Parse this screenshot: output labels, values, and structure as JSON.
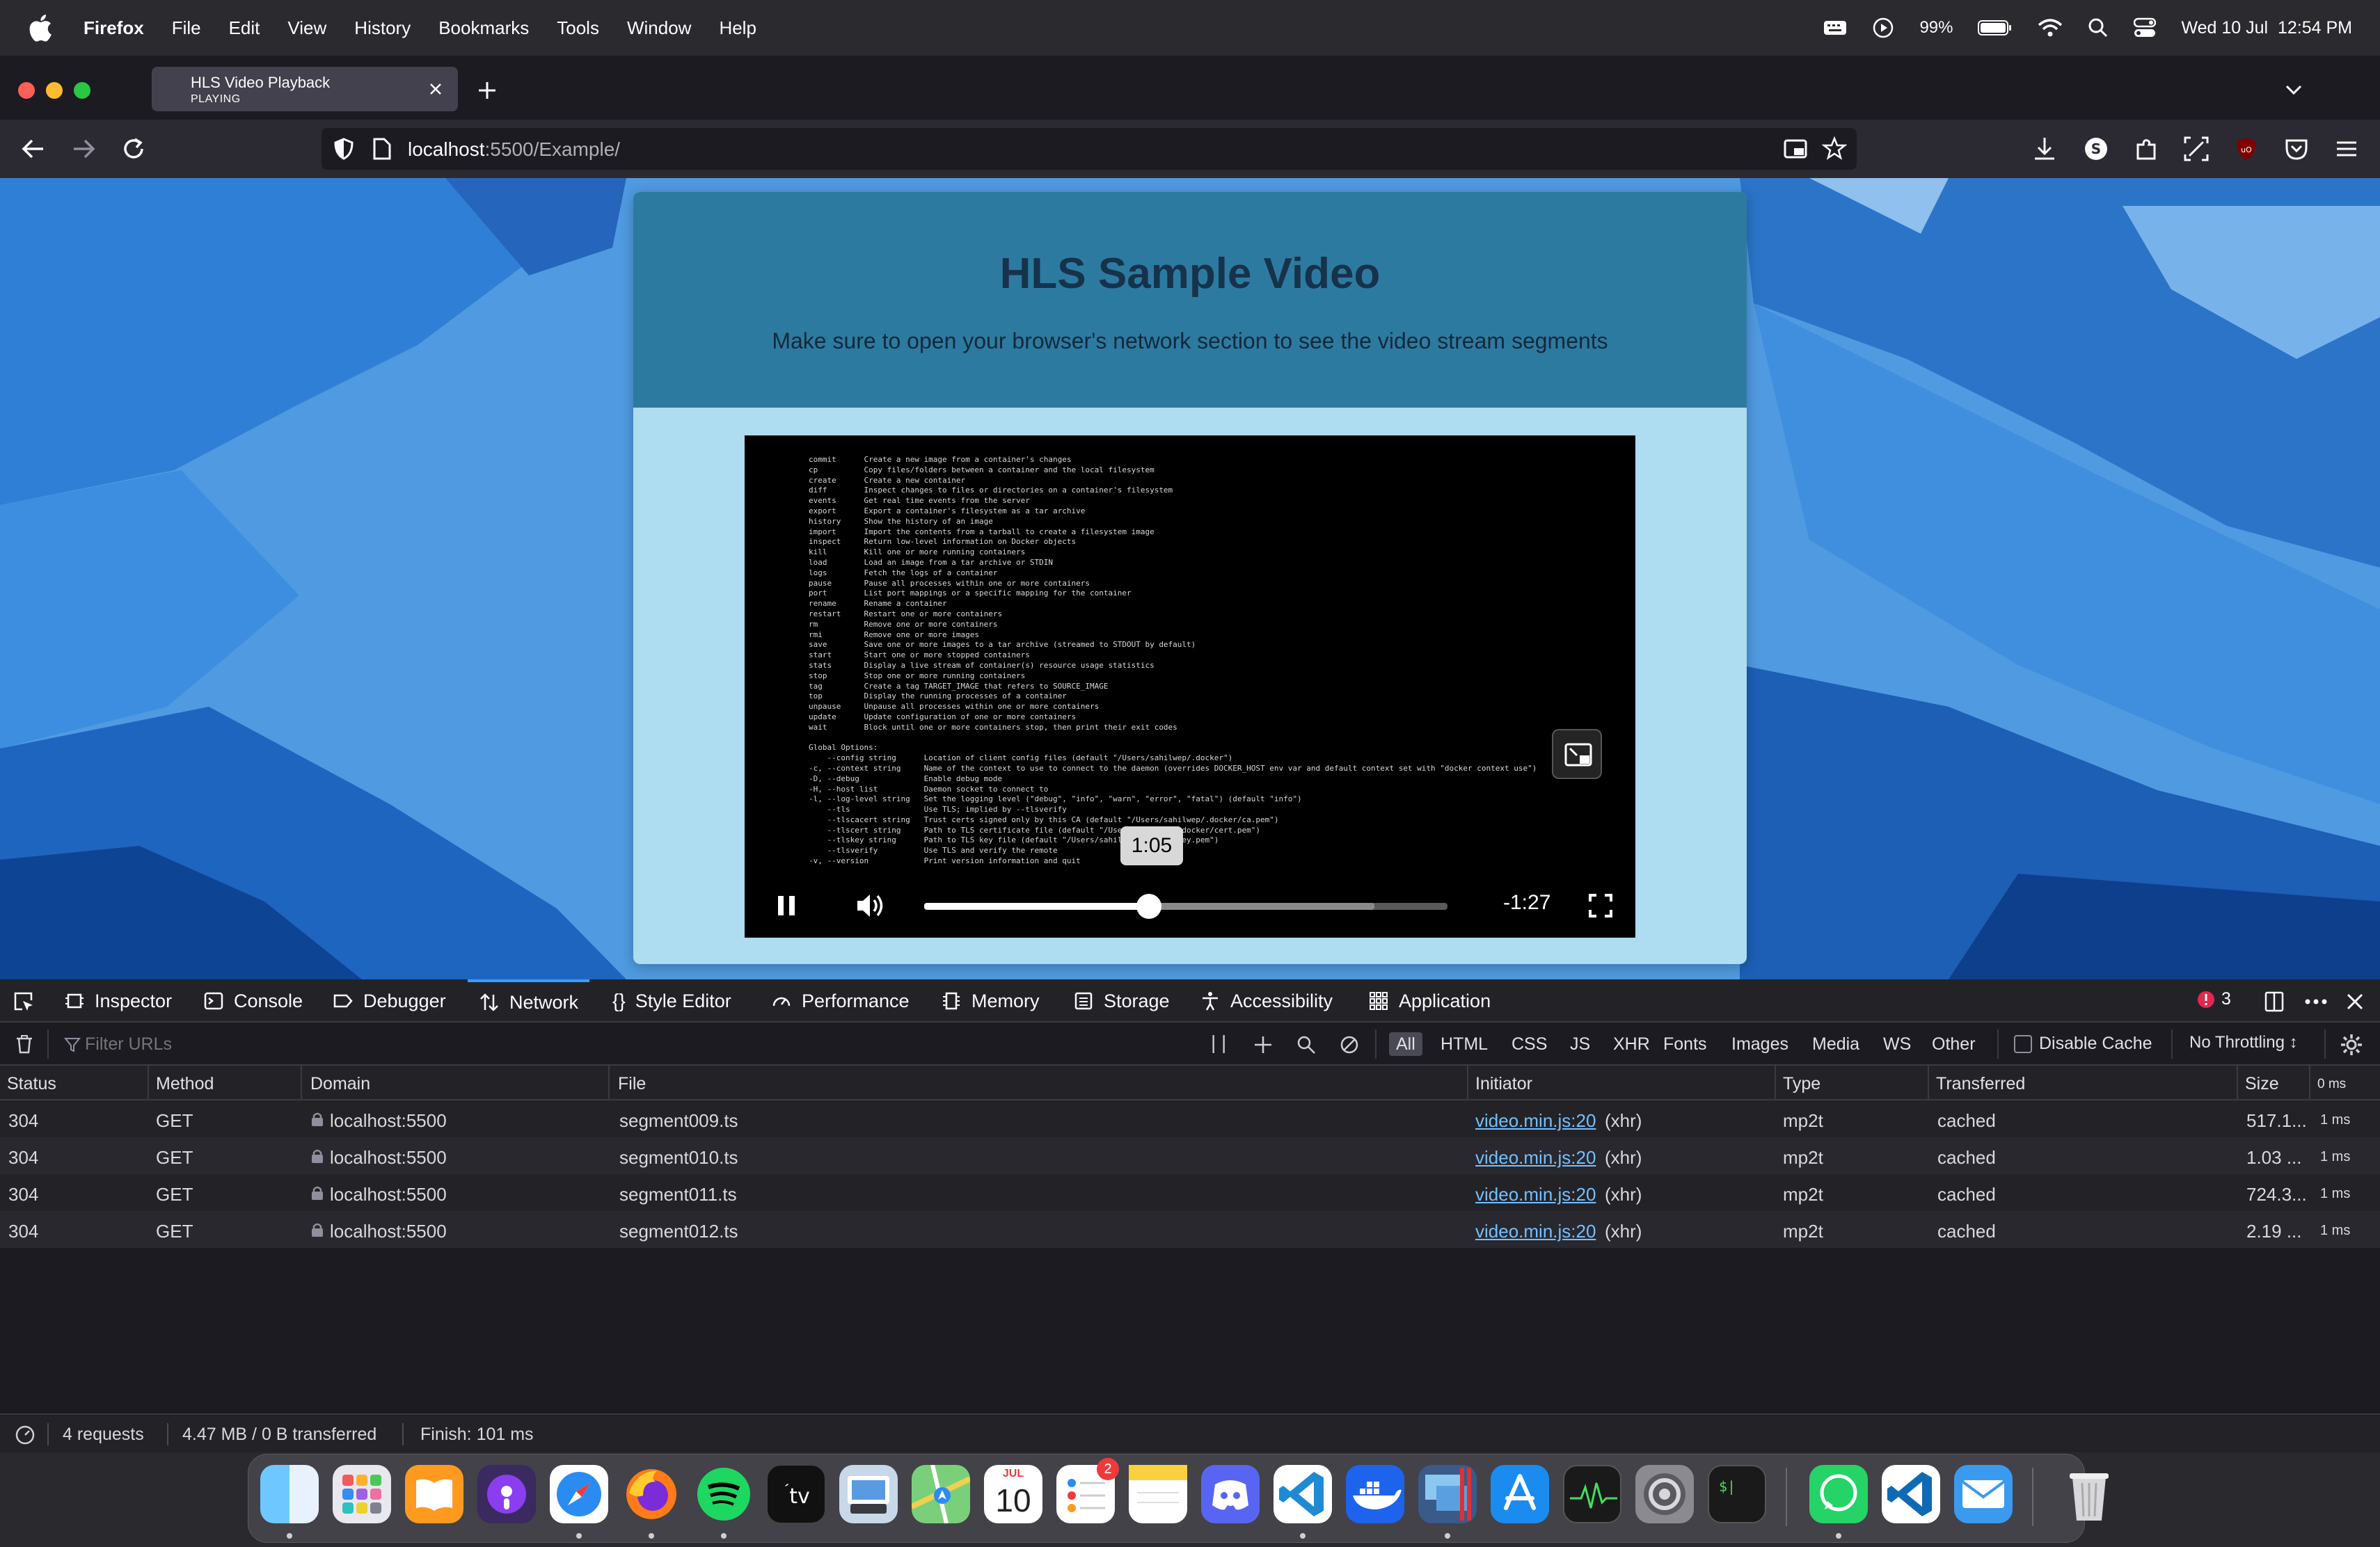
{
  "menubar": {
    "app_name": "Firefox",
    "menus": [
      "File",
      "Edit",
      "View",
      "History",
      "Bookmarks",
      "Tools",
      "Window",
      "Help"
    ],
    "battery": "99%",
    "datetime": "Wed 10 Jul  12:54 PM"
  },
  "browser": {
    "tab": {
      "title": "HLS Video Playback",
      "status": "PLAYING"
    },
    "url": {
      "host": "localhost",
      "rest": ":5500/Example/"
    }
  },
  "page": {
    "title": "HLS Sample Video",
    "subtitle": "Make sure to open your browser's network section to see the video stream segments",
    "player": {
      "tooltip_time": "1:05",
      "remaining_time": "-1:27",
      "played_fraction": 0.43,
      "buffered_fraction": 0.86,
      "terminal_text": "commit      Create a new image from a container's changes\ncp          Copy files/folders between a container and the local filesystem\ncreate      Create a new container\ndiff        Inspect changes to files or directories on a container's filesystem\nevents      Get real time events from the server\nexport      Export a container's filesystem as a tar archive\nhistory     Show the history of an image\nimport      Import the contents from a tarball to create a filesystem image\ninspect     Return low-level information on Docker objects\nkill        Kill one or more running containers\nload        Load an image from a tar archive or STDIN\nlogs        Fetch the logs of a container\npause       Pause all processes within one or more containers\nport        List port mappings or a specific mapping for the container\nrename      Rename a container\nrestart     Restart one or more containers\nrm          Remove one or more containers\nrmi         Remove one or more images\nsave        Save one or more images to a tar archive (streamed to STDOUT by default)\nstart       Start one or more stopped containers\nstats       Display a live stream of container(s) resource usage statistics\nstop        Stop one or more running containers\ntag         Create a tag TARGET_IMAGE that refers to SOURCE_IMAGE\ntop         Display the running processes of a container\nunpause     Unpause all processes within one or more containers\nupdate      Update configuration of one or more containers\nwait        Block until one or more containers stop, then print their exit codes\n\nGlobal Options:\n    --config string      Location of client config files (default \"/Users/sahilwep/.docker\")\n-c, --context string     Name of the context to use to connect to the daemon (overrides DOCKER_HOST env var and default context set with \"docker context use\")\n-D, --debug              Enable debug mode\n-H, --host list          Daemon socket to connect to\n-l, --log-level string   Set the logging level (\"debug\", \"info\", \"warn\", \"error\", \"fatal\") (default \"info\")\n    --tls                Use TLS; implied by --tlsverify\n    --tlscacert string   Trust certs signed only by this CA (default \"/Users/sahilwep/.docker/ca.pem\")\n    --tlscert string     Path to TLS certificate file (default \"/Users/sahilwep/.docker/cert.pem\")\n    --tlskey string      Path to TLS key file (default \"/Users/sahilwep/.docker/key.pem\")\n    --tlsverify          Use TLS and verify the remote\n-v, --version            Print version information and quit"
    }
  },
  "devtools": {
    "tabs": [
      "Inspector",
      "Console",
      "Debugger",
      "Network",
      "Style Editor",
      "Performance",
      "Memory",
      "Storage",
      "Accessibility",
      "Application"
    ],
    "active_tab": "Network",
    "error_count": "3",
    "filter_placeholder": "Filter URLs",
    "type_filters": [
      "All",
      "HTML",
      "CSS",
      "JS",
      "XHR",
      "Fonts",
      "Images",
      "Media",
      "WS",
      "Other"
    ],
    "disable_cache_label": "Disable Cache",
    "throttling": "No Throttling ↕",
    "columns": [
      "Status",
      "Method",
      "Domain",
      "File",
      "Initiator",
      "Type",
      "Transferred",
      "Size",
      "0 ms"
    ],
    "rows": [
      {
        "status": "304",
        "method": "GET",
        "domain": "localhost:5500",
        "file": "segment009.ts",
        "initiator_link": "video.min.js:20",
        "initiator_suffix": "(xhr)",
        "type": "mp2t",
        "transferred": "cached",
        "size": "517.1...",
        "timing": "1 ms"
      },
      {
        "status": "304",
        "method": "GET",
        "domain": "localhost:5500",
        "file": "segment010.ts",
        "initiator_link": "video.min.js:20",
        "initiator_suffix": "(xhr)",
        "type": "mp2t",
        "transferred": "cached",
        "size": "1.03 ...",
        "timing": "1 ms"
      },
      {
        "status": "304",
        "method": "GET",
        "domain": "localhost:5500",
        "file": "segment011.ts",
        "initiator_link": "video.min.js:20",
        "initiator_suffix": "(xhr)",
        "type": "mp2t",
        "transferred": "cached",
        "size": "724.3...",
        "timing": "1 ms"
      },
      {
        "status": "304",
        "method": "GET",
        "domain": "localhost:5500",
        "file": "segment012.ts",
        "initiator_link": "video.min.js:20",
        "initiator_suffix": "(xhr)",
        "type": "mp2t",
        "transferred": "cached",
        "size": "2.19 ...",
        "timing": "1 ms"
      }
    ],
    "status_bar": {
      "requests": "4 requests",
      "size": "4.47 MB / 0 B transferred",
      "finish": "Finish: 101 ms"
    }
  },
  "dock": {
    "apps": [
      "finder-icon",
      "launchpad-icon",
      "books-icon",
      "podcasts-icon",
      "safari-icon",
      "firefox-icon",
      "spotify-icon",
      "apple-tv-icon",
      "preview-icon",
      "maps-icon",
      "calendar-icon",
      "reminders-icon",
      "notes-icon",
      "discord-icon",
      "vscode-icon",
      "docker-icon",
      "screen-sharing-icon",
      "app-store-icon",
      "activity-monitor-icon",
      "system-settings-icon",
      "terminal-icon",
      "whatsapp-icon",
      "vscode-insiders-icon",
      "mail-icon",
      "trash-icon"
    ],
    "calendar_month": "JUL",
    "calendar_day": "10",
    "reminders_badge": "2",
    "tv_label": "tv"
  }
}
